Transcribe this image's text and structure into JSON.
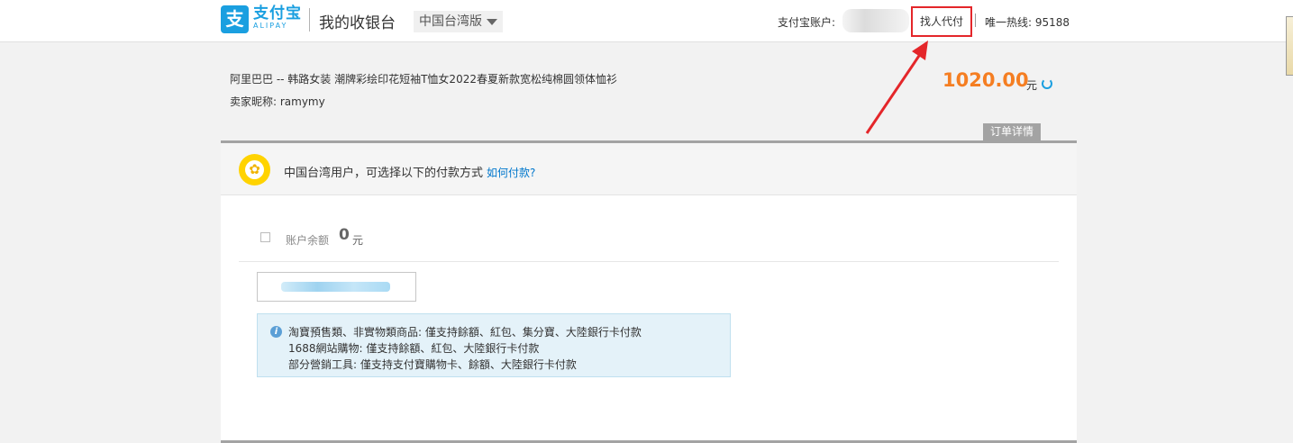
{
  "header": {
    "logo_icon": "支",
    "logo_cn": "支付宝",
    "logo_en": "ALIPAY",
    "cashier_title": "我的收银台",
    "region": "中国台湾版",
    "account_label": "支付宝账户:",
    "proxy_pay": "找人代付",
    "hotline": "唯一热线: 95188",
    "brand_color": "#1a9fe0",
    "highlight_color": "#e4262a"
  },
  "order": {
    "title": "阿里巴巴 -- 韩路女装 潮牌彩绘印花短袖T恤女2022春夏新款宽松纯棉圆领体恤衫",
    "seller": "卖家昵称: ramymy",
    "amount": "1020.00",
    "currency": "元",
    "detail_tab": "订单详情",
    "amount_color": "#f57e22"
  },
  "payment": {
    "header_text": "中国台湾用户，可选择以下的付款方式",
    "how_to_pay": "如何付款?",
    "balance_label": "账户余额",
    "balance_value": "0",
    "balance_unit": "元",
    "notice_lines": [
      "淘寶預售類、非實物類商品: 僅支持餘額、紅包、集分寶、大陸銀行卡付款",
      "1688網站購物: 僅支持餘額、紅包、大陸銀行卡付款",
      "部分營銷工具: 僅支持支付寶購物卡、餘額、大陸銀行卡付款"
    ]
  },
  "icons": {
    "region_caret": "chevron-down-icon",
    "refresh": "refresh-icon",
    "flower": "plum-blossom-icon",
    "info": "info-icon"
  }
}
